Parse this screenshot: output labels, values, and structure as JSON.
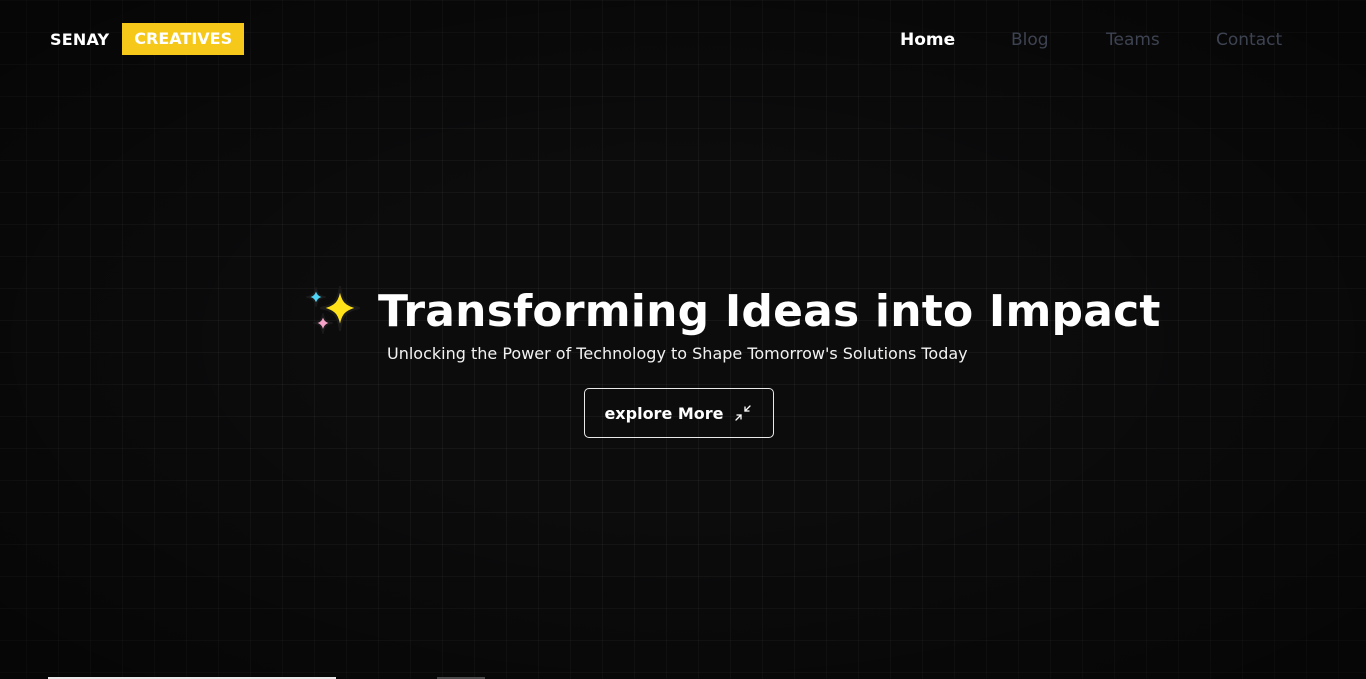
{
  "brand": {
    "first": "SENAY",
    "second": "CREATIVES",
    "accent_color": "#f6c81a"
  },
  "nav": {
    "items": [
      {
        "label": "Home",
        "active": true
      },
      {
        "label": "Blog",
        "active": false
      },
      {
        "label": "Teams",
        "active": false
      },
      {
        "label": "Contact",
        "active": false
      }
    ]
  },
  "hero": {
    "icon": "sparkles-icon",
    "title": "Transforming Ideas into Impact",
    "subtitle": "Unlocking the Power of Technology to Shape Tomorrow's Solutions Today",
    "cta_label": "explore More",
    "cta_icon": "arrows-in-icon"
  },
  "colors": {
    "background": "#0c0c0d",
    "nav_inactive": "#3d4351",
    "text": "#ffffff"
  }
}
